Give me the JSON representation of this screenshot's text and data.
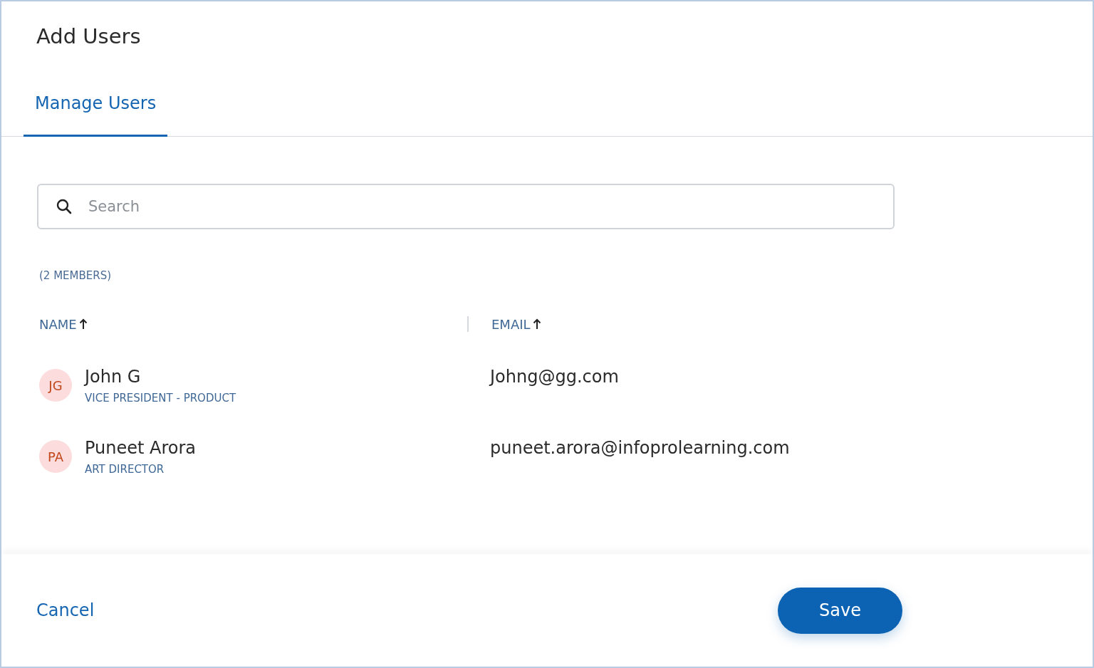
{
  "dialog": {
    "title": "Add Users"
  },
  "tabs": [
    {
      "label": "Manage Users",
      "selected": true
    }
  ],
  "search": {
    "placeholder": "Search"
  },
  "member_count": "(2 MEMBERS)",
  "table": {
    "columns": [
      {
        "label": "NAME",
        "sorted": true
      },
      {
        "label": "EMAIL",
        "sorted": true
      }
    ],
    "rows": [
      {
        "initials": "JG",
        "name": "John G",
        "role": "VICE PRESIDENT - PRODUCT",
        "email": "Johng@gg.com"
      },
      {
        "initials": "PA",
        "name": "Puneet Arora",
        "role": "ART DIRECTOR",
        "email": "puneet.arora@infoprolearning.com"
      }
    ]
  },
  "footer": {
    "cancel": "Cancel",
    "save": "Save"
  }
}
